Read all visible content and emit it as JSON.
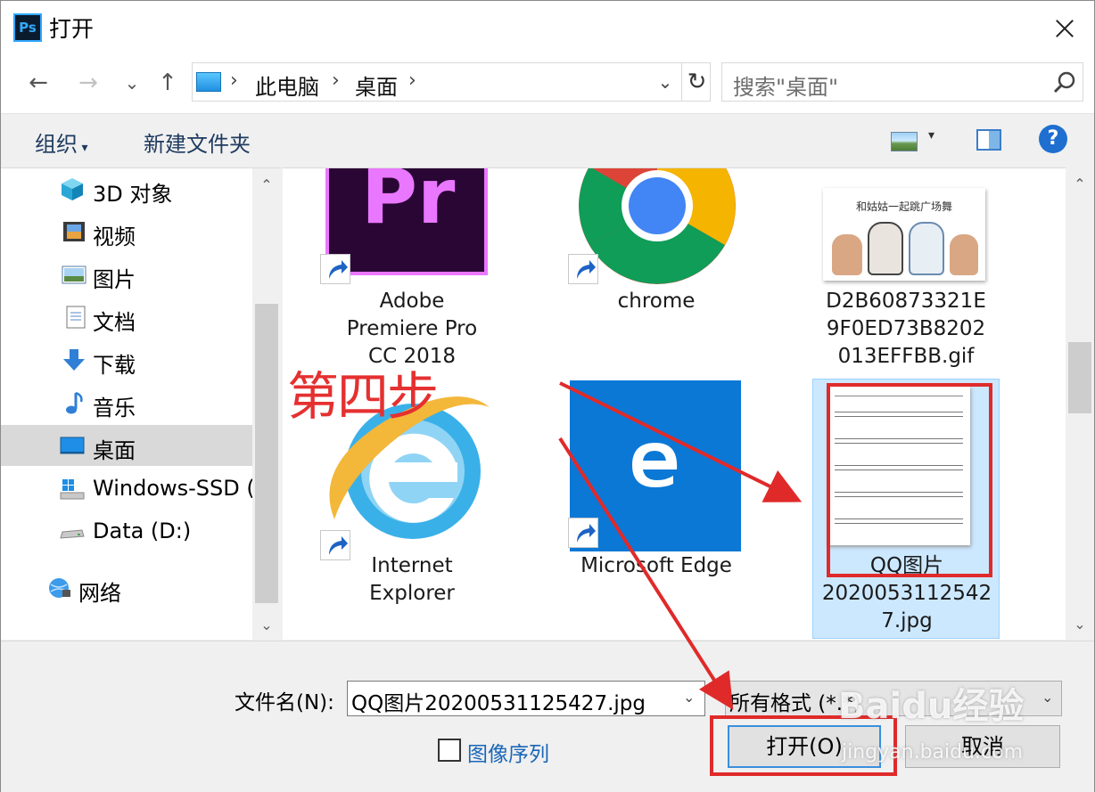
{
  "window": {
    "title": "打开",
    "app_icon": "Ps"
  },
  "nav": {
    "back": "←",
    "forward": "→",
    "recent": "⌄",
    "up": "↑",
    "breadcrumb": [
      "此电脑",
      "桌面"
    ],
    "refresh": "↻",
    "search_placeholder": "搜索\"桌面\""
  },
  "toolbar": {
    "organize": "组织",
    "new_folder": "新建文件夹",
    "help": "?"
  },
  "sidebar": {
    "items": [
      {
        "label": "3D 对象",
        "icon": "3d-objects-icon"
      },
      {
        "label": "视频",
        "icon": "videos-icon"
      },
      {
        "label": "图片",
        "icon": "pictures-icon"
      },
      {
        "label": "文档",
        "icon": "documents-icon"
      },
      {
        "label": "下载",
        "icon": "downloads-icon"
      },
      {
        "label": "音乐",
        "icon": "music-icon"
      },
      {
        "label": "桌面",
        "icon": "desktop-icon",
        "selected": true
      },
      {
        "label": "Windows-SSD (",
        "icon": "windows-drive-icon"
      },
      {
        "label": "Data (D:)",
        "icon": "drive-icon"
      },
      {
        "label": "网络",
        "icon": "network-icon"
      }
    ]
  },
  "files": [
    {
      "name_lines": [
        "Adobe",
        "Premiere Pro",
        "CC 2018"
      ],
      "icon": "premiere-pro-icon",
      "icon_text": "Pr",
      "shortcut": true
    },
    {
      "name_lines": [
        "chrome"
      ],
      "icon": "chrome-icon",
      "shortcut": true
    },
    {
      "name_lines": [
        "D2B60873321E",
        "9F0ED73B8202",
        "013EFFBB.gif"
      ],
      "icon": "gif-thumbnail",
      "thumb_caption": "和姑姑一起跳广场舞",
      "shortcut": false
    },
    {
      "name_lines": [
        "Internet",
        "Explorer"
      ],
      "icon": "internet-explorer-icon",
      "shortcut": true
    },
    {
      "name_lines": [
        "Microsoft Edge"
      ],
      "icon": "edge-icon",
      "shortcut": true
    },
    {
      "name_lines": [
        "QQ图片",
        "2020053112542",
        "7.jpg"
      ],
      "icon": "sheet-music-thumbnail",
      "shortcut": false,
      "selected": true
    }
  ],
  "bottom": {
    "filename_label": "文件名(N):",
    "filename_value": "QQ图片20200531125427.jpg",
    "filetype_value": "所有格式 (*.*)",
    "image_sequence_label": "图像序列",
    "open_label": "打开(O)",
    "cancel_label": "取消"
  },
  "annotation": {
    "step_text": "第四步",
    "color": "#e02a2a"
  },
  "watermark": {
    "main": "Baidu经验",
    "sub": "jingyan.baidu.com"
  },
  "colors": {
    "selection": "#cce8ff",
    "accent": "#1f6fd0",
    "annotation": "#e02a2a"
  }
}
